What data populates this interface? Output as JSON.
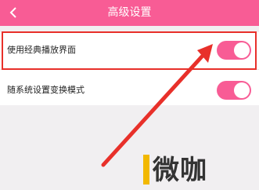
{
  "header": {
    "title": "高级设置",
    "back_icon": "chevron-left-icon",
    "background_color": "#f85c95"
  },
  "settings": [
    {
      "label": "使用经典播放界面",
      "enabled": true
    },
    {
      "label": "随系统设置变换模式",
      "enabled": true
    }
  ],
  "annotation": {
    "highlight_color": "#e8302a",
    "arrow": "arrow-pointing-to-toggle"
  },
  "watermark": {
    "text": "微咖",
    "accent_color": "#f2b800"
  }
}
